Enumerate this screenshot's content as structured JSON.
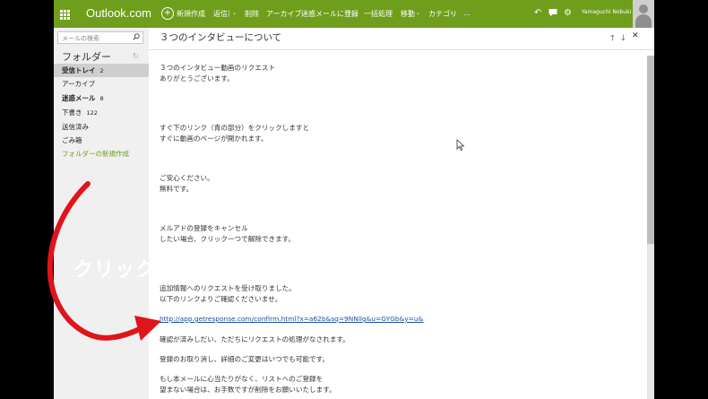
{
  "topbar": {
    "brand": "Outlook.com",
    "new_label": "新規作成",
    "commands": [
      "返信",
      "|",
      "削除",
      "アーカイブ",
      "迷惑メールに登録",
      "一括処理",
      "移動",
      "カテゴリ",
      "…"
    ],
    "user_name": "Yamaguchi Nobuki"
  },
  "sidebar": {
    "search_placeholder": "メールの検索",
    "folders_heading": "フォルダー",
    "items": [
      {
        "label": "受信トレイ",
        "count": "2"
      },
      {
        "label": "アーカイブ",
        "count": ""
      },
      {
        "label": "迷惑メール",
        "count": "8"
      },
      {
        "label": "下書き",
        "count": "122"
      },
      {
        "label": "送信済み",
        "count": ""
      },
      {
        "label": "ごみ箱",
        "count": ""
      }
    ],
    "new_folder": "フォルダーの新規作成"
  },
  "message": {
    "subject": "３つのインタビューについて",
    "paragraphs": [
      [
        "３つのインタビュー動画のリクエスト",
        "ありがとうございます。"
      ],
      [
        "すぐ下のリンク（青の部分）をクリックしますと",
        "すぐに動画のページが開かれます。"
      ],
      [
        "ご安心ください。",
        "無料です。"
      ],
      [
        "メルアドの登録をキャンセル",
        "したい場合、クリック一つで解除できます。"
      ],
      [
        "追加情報へのリクエストを受け取りました。",
        "以下のリンクよりご確認くださいませ。"
      ],
      [
        "確認が済みしだい、ただちにリクエストの処理がなされます。"
      ],
      [
        "登録のお取り消し、詳細のご変更はいつでも可能です。"
      ],
      [
        "もし本メールに心当たりがなく、リストへのご登録を",
        "望まない場合は、お手数ですが削除をお願いいたします。"
      ]
    ],
    "link": "http://app.getresponse.com/confirm.html?x=a62b&sq=9NNllg&u=GYGb&y=u&"
  },
  "annotation": {
    "label": "クリック",
    "arrow_color": "#e0141b"
  }
}
